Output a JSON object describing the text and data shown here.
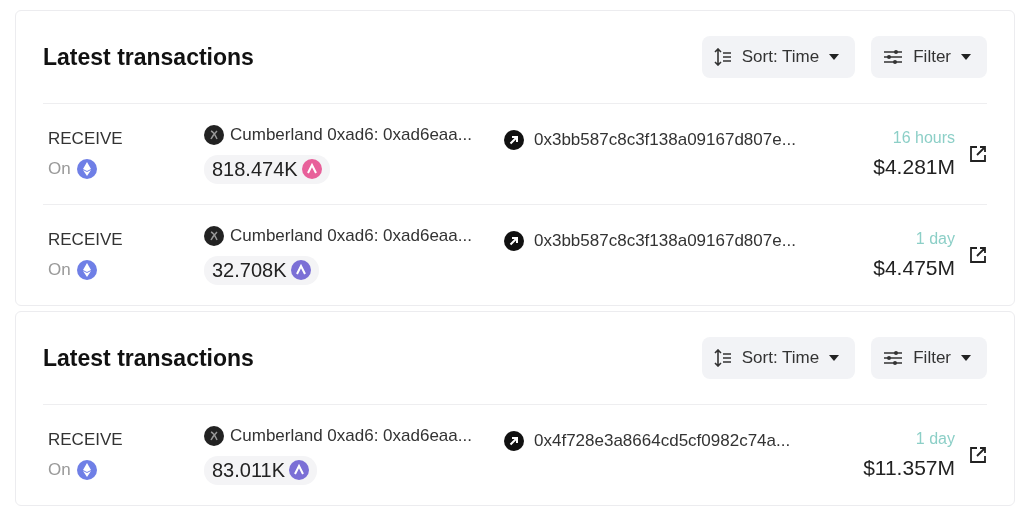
{
  "panels": [
    {
      "title": "Latest transactions",
      "sort": "Sort: Time",
      "filter": "Filter",
      "rows": [
        {
          "type": "RECEIVE",
          "chain": "On",
          "from": "Cumberland 0xad6: 0xad6eaa...",
          "to": "0x3bb587c8c3f138a09167d807e...",
          "amount": "818.474K",
          "token": {
            "color": "#e8609a"
          },
          "time": "16 hours",
          "value": "$4.281M"
        },
        {
          "type": "RECEIVE",
          "chain": "On",
          "from": "Cumberland 0xad6: 0xad6eaa...",
          "to": "0x3bb587c8c3f138a09167d807e...",
          "amount": "32.708K",
          "token": {
            "color": "#7b6fd6"
          },
          "time": "1 day",
          "value": "$4.475M"
        }
      ]
    },
    {
      "title": "Latest transactions",
      "sort": "Sort: Time",
      "filter": "Filter",
      "rows": [
        {
          "type": "RECEIVE",
          "chain": "On",
          "from": "Cumberland 0xad6: 0xad6eaa...",
          "to": "0x4f728e3a8664cd5cf0982c74a...",
          "amount": "83.011K",
          "token": {
            "color": "#7b6fd6"
          },
          "time": "1 day",
          "value": "$11.357M"
        }
      ]
    }
  ]
}
